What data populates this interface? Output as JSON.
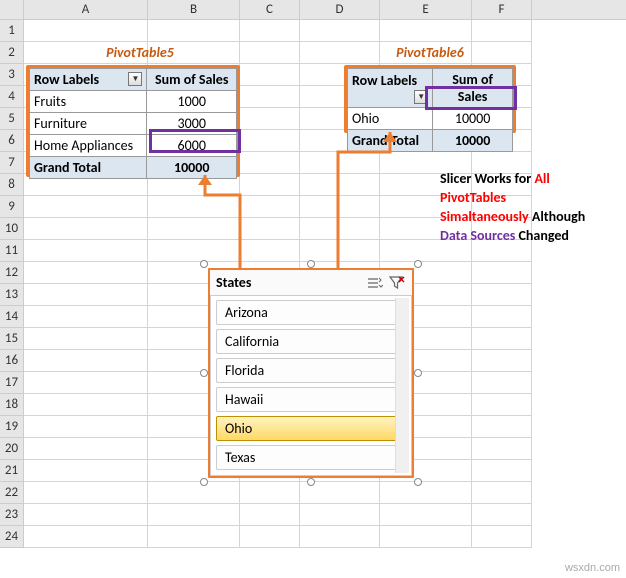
{
  "columns": [
    "A",
    "B",
    "C",
    "D",
    "E",
    "F"
  ],
  "row_count": 24,
  "captions": {
    "pivot5": "PivotTable5",
    "pivot6": "PivotTable6"
  },
  "pivot5": {
    "header_label": "Row Labels",
    "header_value": "Sum of Sales",
    "rows": [
      {
        "label": "Fruits",
        "value": "1000"
      },
      {
        "label": "Furniture",
        "value": "3000"
      },
      {
        "label": "Home Appliances",
        "value": "6000"
      }
    ],
    "grand_label": "Grand Total",
    "grand_value": "10000"
  },
  "pivot6": {
    "header_label": "Row Labels",
    "header_value": "Sum of Sales",
    "rows": [
      {
        "label": "Ohio",
        "value": "10000"
      }
    ],
    "grand_label": "Grand Total",
    "grand_value": "10000"
  },
  "slicer": {
    "title": "States",
    "items": [
      "Arizona",
      "California",
      "Florida",
      "Hawaii",
      "Ohio",
      "Texas"
    ],
    "selected": "Ohio"
  },
  "annotation": {
    "l1a": "Slicer Works for ",
    "l1b": "All",
    "l2": "PivotTables",
    "l3a": "Simaltaneously ",
    "l3b": "Although",
    "l4a": "Data Sources ",
    "l4b": "Changed"
  },
  "icons": {
    "multi_select": "multi-select-icon",
    "clear_filter": "clear-filter-icon",
    "filter_dropdown": "▼"
  },
  "watermark": "wsxdn.com"
}
